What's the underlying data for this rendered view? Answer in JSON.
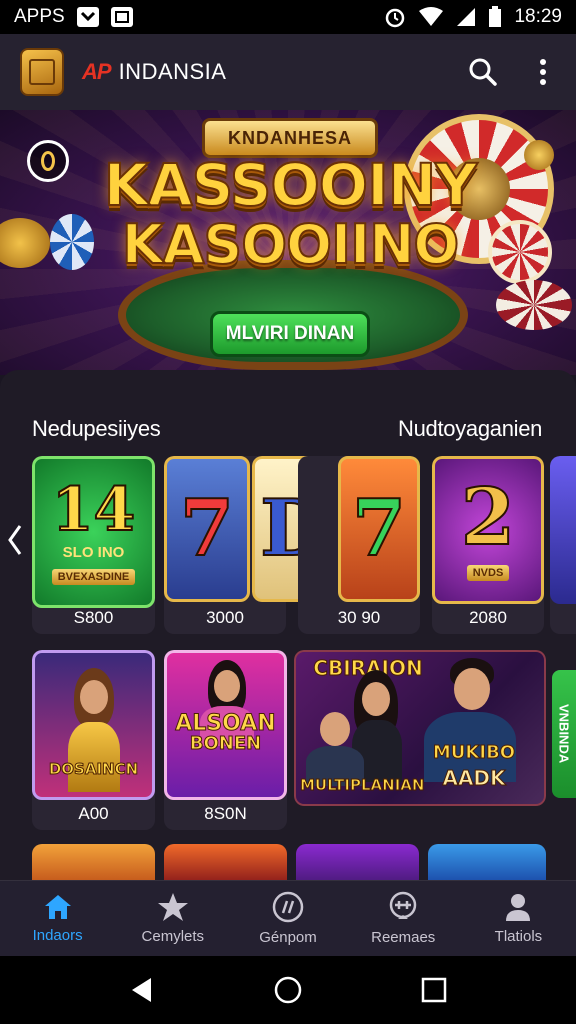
{
  "status_bar": {
    "carrier": "APPS",
    "time": "18:29"
  },
  "app_bar": {
    "brand_mark": "AP",
    "brand_name": "INDANSIA"
  },
  "hero": {
    "ribbon": "KNDANHESA",
    "title_line1": "KASSOOINY",
    "title_line2": "KASOOIINO",
    "cta_label": "MLVIRI DINAN"
  },
  "sections": {
    "left_title": "Nedupesiiyes",
    "right_title": "Nudtoyaganien"
  },
  "slot_games": [
    {
      "art": "14",
      "sub": "SLO INO",
      "tag": "BVEXASDINE",
      "caption": "S800",
      "theme": "green"
    },
    {
      "art": "7",
      "sub": "",
      "tag": "",
      "caption": "3000",
      "theme": "blue"
    },
    {
      "art": "D",
      "sub": "",
      "tag": "",
      "caption": "",
      "theme": "cream"
    },
    {
      "art": "7",
      "sub": "",
      "tag": "",
      "caption": "30 90",
      "theme": "orange"
    },
    {
      "art": "2",
      "sub": "",
      "tag": "NVDS",
      "caption": "2080",
      "theme": "purple"
    }
  ],
  "promo_games": [
    {
      "label": "DOSAINCN",
      "caption": "A00"
    },
    {
      "label_line1": "ALSOAN",
      "label_line2": "BONEN",
      "caption": "8S0N"
    },
    {
      "label_top": "CBIRAION",
      "label_mid": "MUKIBO",
      "label_bottom": "AADK",
      "label_banner": "MULTIPLANIAN",
      "caption": ""
    }
  ],
  "side_tab": {
    "label": "VNBINDA"
  },
  "bottom_nav": [
    {
      "label": "Indaors",
      "icon": "home-icon",
      "active": true
    },
    {
      "label": "Cemylets",
      "icon": "star-icon",
      "active": false
    },
    {
      "label": "Génpom",
      "icon": "compass-icon",
      "active": false
    },
    {
      "label": "Reemaes",
      "icon": "gamepad-icon",
      "active": false
    },
    {
      "label": "Tlatiols",
      "icon": "profile-icon",
      "active": false
    }
  ],
  "colors": {
    "accent": "#2ea6ff",
    "gold": "#ffd23e",
    "cta_green": "#1d9a2c",
    "brand_red": "#e53223"
  }
}
